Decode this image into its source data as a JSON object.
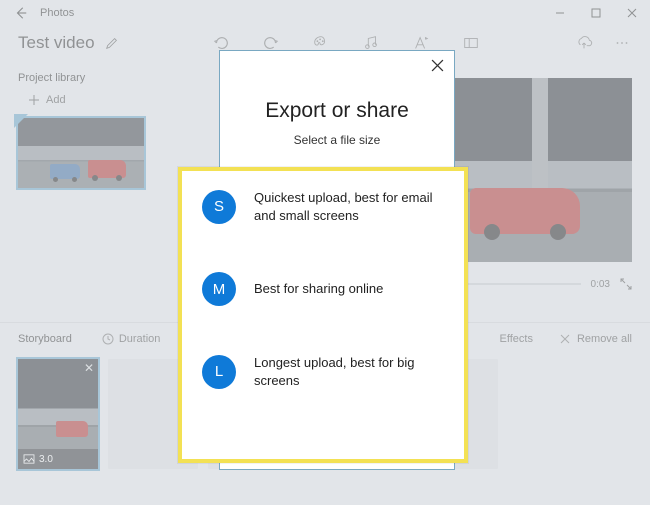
{
  "titlebar": {
    "app_name": "Photos"
  },
  "header": {
    "video_title": "Test video"
  },
  "library": {
    "title": "Project library",
    "add_label": "Add"
  },
  "progress": {
    "time": "0:03"
  },
  "storyboard": {
    "title": "Storyboard",
    "duration_label": "Duration",
    "effects_label": "Effects",
    "remove_all_label": "Remove all",
    "clip_duration": "3.0"
  },
  "dialog": {
    "title": "Export or share",
    "subtitle": "Select a file size",
    "options": [
      {
        "badge": "S",
        "desc": "Quickest upload, best for email and small screens"
      },
      {
        "badge": "M",
        "desc": "Best for sharing online"
      },
      {
        "badge": "L",
        "desc": "Longest upload, best for big screens"
      }
    ]
  }
}
